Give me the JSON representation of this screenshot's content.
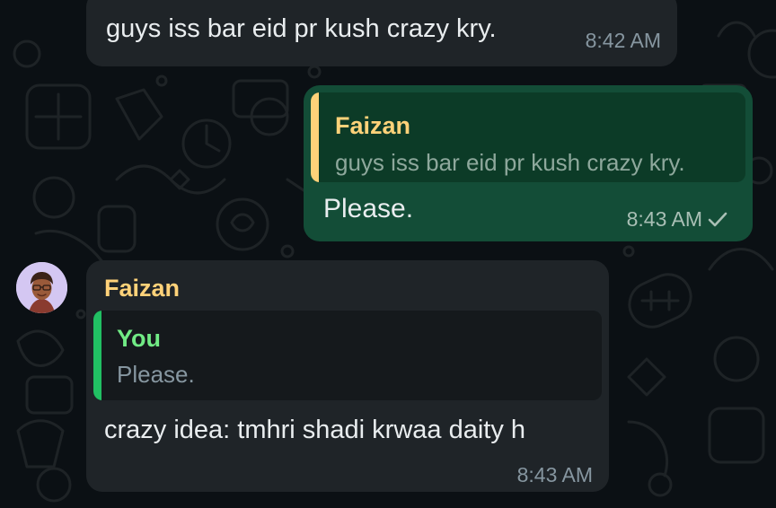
{
  "colors": {
    "chat_background": "#0b1014",
    "incoming_bubble": "#1f2428",
    "outgoing_bubble": "#134d37",
    "sender_name": "#ffd279",
    "self_quote_name": "#71eb85",
    "self_quote_bar": "#21c063",
    "message_text": "#e9edef",
    "timestamp": "#8696a0"
  },
  "messages": [
    {
      "direction": "incoming",
      "text": "guys iss bar eid pr kush crazy kry.",
      "time": "8:42 AM"
    },
    {
      "direction": "outgoing",
      "quoted": {
        "author": "Faizan",
        "text": "guys iss bar eid pr kush crazy kry."
      },
      "text": "Please.",
      "time": "8:43 AM",
      "status_icon": "single-check-icon"
    },
    {
      "direction": "incoming",
      "sender": "Faizan",
      "avatar_icon": "memoji-avatar-icon",
      "quoted": {
        "author": "You",
        "text": "Please."
      },
      "text": "crazy idea: tmhri shadi krwaa daity h",
      "time": "8:43 AM"
    }
  ]
}
